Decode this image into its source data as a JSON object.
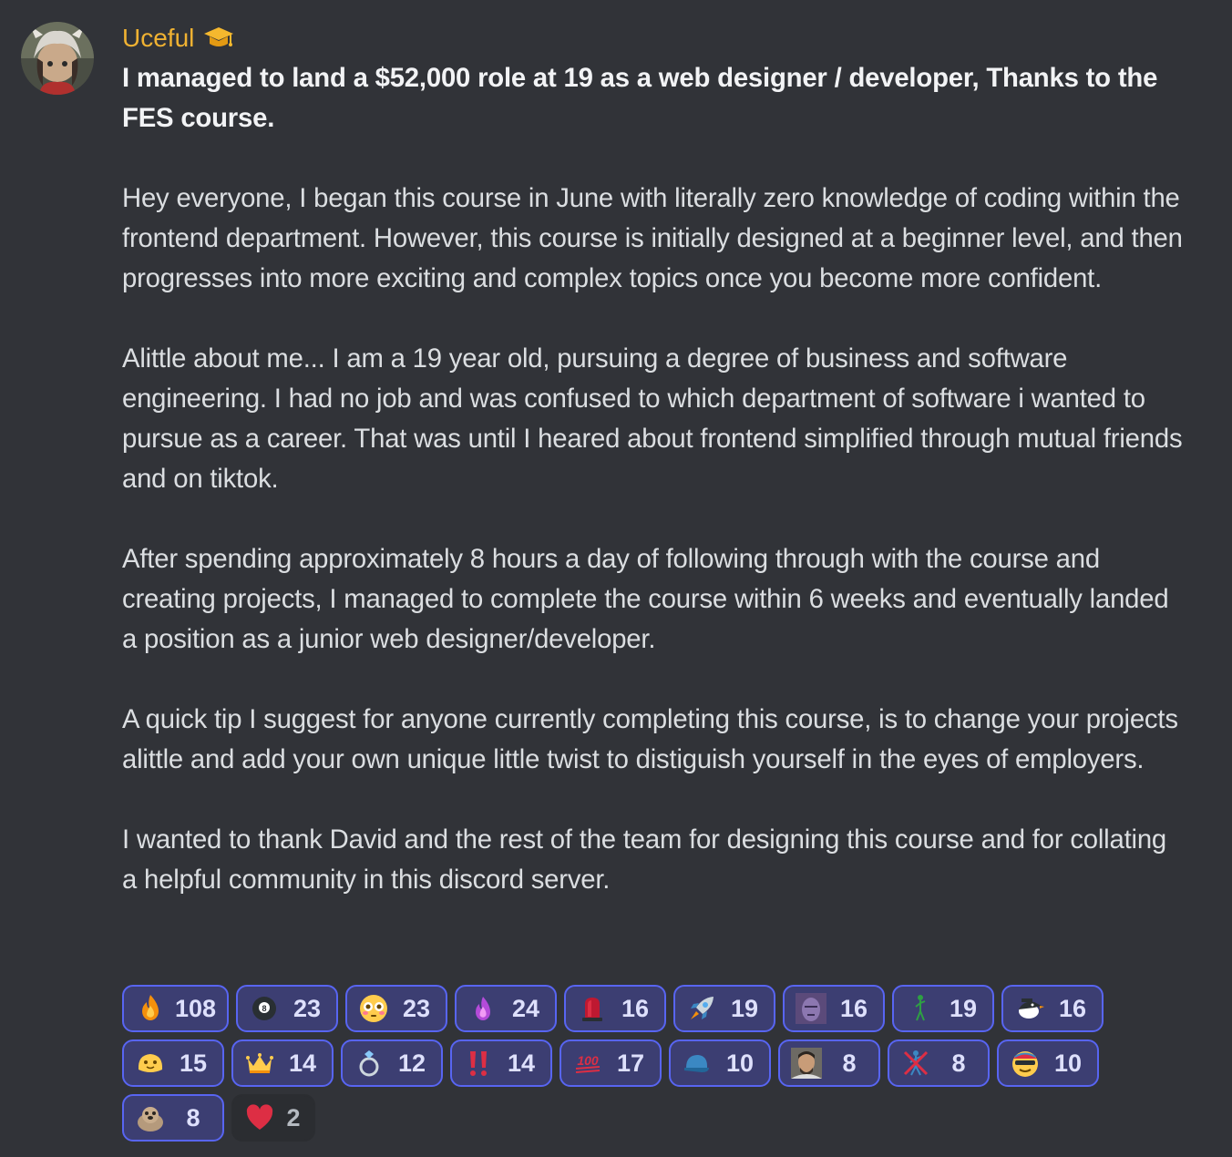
{
  "message": {
    "username": "Uceful",
    "role_icon": "graduation-cap-icon",
    "title": "I managed to land a $52,000 role at 19 as a web designer / developer, Thanks to the FES course.",
    "paragraphs": [
      "Hey everyone, I began this course in June with literally zero knowledge of coding within the frontend department. However, this course is initially designed at a beginner level, and then progresses into more exciting and complex topics once you become more confident.",
      "Alittle about me... I am a 19 year old, pursuing a degree of business and software engineering. I had no job and was confused to which department of software i wanted to pursue as a career. That was until I heared about frontend simplified through mutual friends and on tiktok.",
      "After spending approximately 8 hours a day of following through with the course and creating projects, I managed to complete the course within 6 weeks and eventually landed a position as a junior web designer/developer.",
      "A quick tip I suggest for anyone currently completing this course, is to change your projects alittle and add your own unique little twist to distiguish yourself in the eyes of employers.",
      "I wanted to thank David and the rest of the team for designing this course and for collating a helpful community in this discord server."
    ]
  },
  "reactions": [
    {
      "icon": "fire-icon",
      "count": "108",
      "reacted": true
    },
    {
      "icon": "eight-ball-icon",
      "count": "23",
      "reacted": true
    },
    {
      "icon": "flushed-face-icon",
      "count": "23",
      "reacted": true
    },
    {
      "icon": "purple-fire-icon",
      "count": "24",
      "reacted": true
    },
    {
      "icon": "red-siren-icon",
      "count": "16",
      "reacted": true
    },
    {
      "icon": "rocket-icon",
      "count": "19",
      "reacted": true
    },
    {
      "icon": "thanos-icon",
      "count": "16",
      "reacted": true
    },
    {
      "icon": "dancing-stickman-icon",
      "count": "19",
      "reacted": true
    },
    {
      "icon": "penguin-icon",
      "count": "16",
      "reacted": true
    },
    {
      "icon": "yellow-blob-icon",
      "count": "15",
      "reacted": true
    },
    {
      "icon": "crown-icon",
      "count": "14",
      "reacted": true
    },
    {
      "icon": "ring-icon",
      "count": "12",
      "reacted": true
    },
    {
      "icon": "double-exclamation-icon",
      "count": "14",
      "reacted": true
    },
    {
      "icon": "hundred-points-icon",
      "count": "17",
      "reacted": true
    },
    {
      "icon": "blue-cap-icon",
      "count": "10",
      "reacted": true
    },
    {
      "icon": "man-photo-icon",
      "count": "8",
      "reacted": true
    },
    {
      "icon": "no-dancing-icon",
      "count": "8",
      "reacted": true
    },
    {
      "icon": "cool-face-icon",
      "count": "10",
      "reacted": true
    },
    {
      "icon": "seal-icon",
      "count": "8",
      "reacted": true
    },
    {
      "icon": "red-heart-icon",
      "count": "2",
      "reacted": false
    }
  ]
}
